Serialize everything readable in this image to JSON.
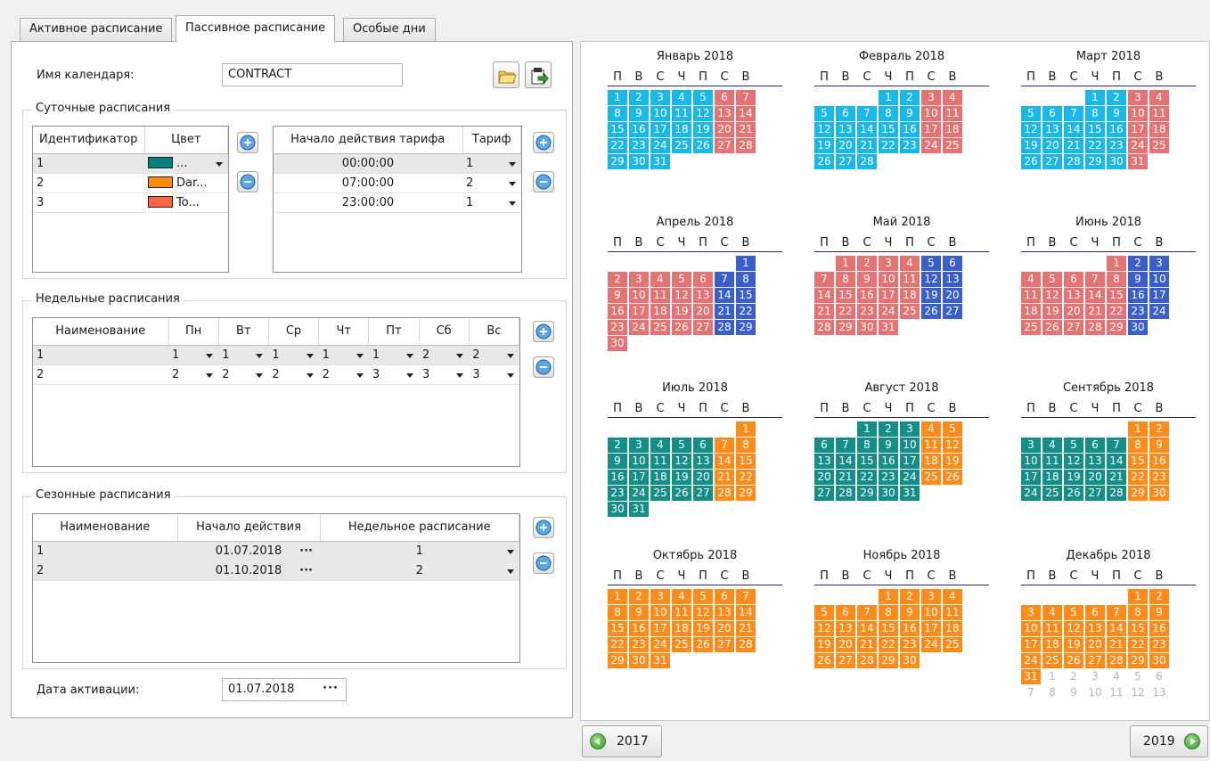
{
  "tabs": [
    "Активное расписание",
    "Пассивное расписание",
    "Особые дни"
  ],
  "active_tab": 1,
  "calendar_name": {
    "label": "Имя календаря:",
    "value": "CONTRACT"
  },
  "daily": {
    "title": "Суточные расписания",
    "ids_headers": [
      "Идентификатор",
      "Цвет"
    ],
    "ids_rows": [
      {
        "id": "1",
        "color": "#00807a",
        "color_text": "..."
      },
      {
        "id": "2",
        "color": "#ff8c00",
        "color_text": "Dar..."
      },
      {
        "id": "3",
        "color": "#ff6347",
        "color_text": "To..."
      }
    ],
    "tariff_headers": [
      "Начало действия тарифа",
      "Тариф"
    ],
    "tariff_rows": [
      {
        "time": "00:00:00",
        "tariff": "1"
      },
      {
        "time": "07:00:00",
        "tariff": "2"
      },
      {
        "time": "23:00:00",
        "tariff": "1"
      }
    ]
  },
  "weekly": {
    "title": "Недельные расписания",
    "headers": [
      "Наименование",
      "Пн",
      "Вт",
      "Ср",
      "Чт",
      "Пт",
      "Сб",
      "Вс"
    ],
    "rows": [
      [
        "1",
        "1",
        "1",
        "1",
        "1",
        "1",
        "2",
        "2"
      ],
      [
        "2",
        "2",
        "2",
        "2",
        "2",
        "3",
        "3",
        "3"
      ]
    ]
  },
  "seasonal": {
    "title": "Сезонные расписания",
    "headers": [
      "Наименование",
      "Начало действия",
      "Недельное расписание"
    ],
    "rows": [
      {
        "name": "1",
        "start": "01.07.2018",
        "weekly": "1"
      },
      {
        "name": "2",
        "start": "01.10.2018",
        "weekly": "2"
      }
    ]
  },
  "activation": {
    "label": "Дата активации:",
    "value": "01.07.2018"
  },
  "calendar": {
    "year": 2018,
    "weekday_labels": [
      "П",
      "В",
      "С",
      "Ч",
      "П",
      "С",
      "В"
    ],
    "months": [
      "Январь 2018",
      "Февраль 2018",
      "Март 2018",
      "Апрель 2018",
      "Май 2018",
      "Июнь 2018",
      "Июль 2018",
      "Август 2018",
      "Сентябрь 2018",
      "Октябрь 2018",
      "Ноябрь 2018",
      "Декабрь 2018"
    ],
    "colors": {
      "cyan": "#1ab8e6",
      "pink": "#e57373",
      "blue": "#3a5fcd",
      "teal": "#138f87",
      "orange": "#ff8c1a"
    },
    "prev_year": "2017",
    "next_year": "2019"
  }
}
